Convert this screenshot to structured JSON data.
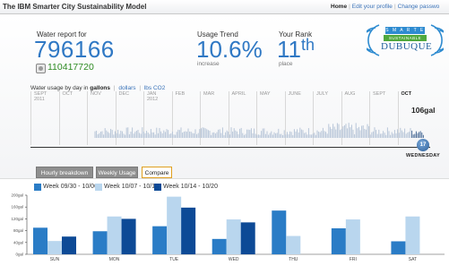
{
  "header": {
    "title": "The IBM Smarter City Sustainability Model",
    "nav": {
      "home": "Home",
      "edit_profile": "Edit your profile",
      "change_password": "Change passwo"
    }
  },
  "report": {
    "label": "Water report for",
    "number": "796166",
    "account_number": "110417720"
  },
  "trend": {
    "label": "Usage Trend",
    "value": "10.6%",
    "sub": "increase"
  },
  "rank": {
    "label": "Your Rank",
    "value": "11",
    "suffix": "th",
    "sub": "place"
  },
  "logo": {
    "line1": "S M A R T E R",
    "line2": "SUSTAINABLE",
    "line3": "DUBUQUE"
  },
  "usage": {
    "prefix": "Water usage by day in",
    "units": [
      "gallons",
      "dollars",
      "lbs CO2"
    ],
    "active_unit": "gallons"
  },
  "timeline": {
    "months": [
      "SEPT\n2011",
      "OCT",
      "NOV",
      "DEC",
      "JAN\n2012",
      "FEB",
      "MAR",
      "APRIL",
      "MAY",
      "JUNE",
      "JULY",
      "AUG",
      "SEPT",
      "OCT"
    ],
    "current_value": "106gal",
    "current_day_number": "17",
    "current_day_name": "WEDNESDAY"
  },
  "tabs": [
    {
      "label": "Hourly breakdown",
      "active": false
    },
    {
      "label": "Weekly Usage",
      "active": false
    },
    {
      "label": "Compare",
      "active": true
    }
  ],
  "colors": {
    "accent": "#2f78c4",
    "week1": "#2a7cc6",
    "week2": "#b9d6ee",
    "week3": "#0d4a96"
  },
  "chart_data": {
    "type": "bar",
    "categories": [
      "SUN",
      "MON",
      "TUE",
      "WED",
      "THU",
      "FRI",
      "SAT"
    ],
    "series": [
      {
        "name": "Week 09/30 - 10/06",
        "values": [
          90,
          78,
          95,
          52,
          148,
          88,
          44
        ]
      },
      {
        "name": "Week 10/07 - 10/13",
        "values": [
          45,
          128,
          195,
          118,
          62,
          118,
          128
        ]
      },
      {
        "name": "Week 10/14 - 10/20",
        "values": [
          60,
          120,
          158,
          108,
          0,
          0,
          0
        ]
      }
    ],
    "ylim": [
      0,
      200
    ],
    "yticks": [
      "0gal",
      "40gal",
      "80gal",
      "120gal",
      "160gal",
      "200gal"
    ]
  }
}
